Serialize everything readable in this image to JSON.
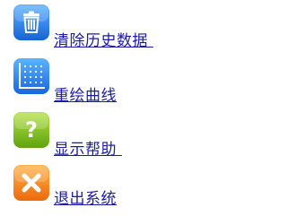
{
  "menu": {
    "items": [
      {
        "label": "清除历史数据 ",
        "icon": "trash-icon",
        "color": "#2c7fe8"
      },
      {
        "label": "重绘曲线",
        "icon": "chart-grid-icon",
        "color": "#2b86f0"
      },
      {
        "label": "显示帮助 ",
        "icon": "help-icon",
        "color": "#86c41a"
      },
      {
        "label": "退出系统",
        "icon": "close-icon",
        "color": "#f28a1e"
      }
    ]
  }
}
